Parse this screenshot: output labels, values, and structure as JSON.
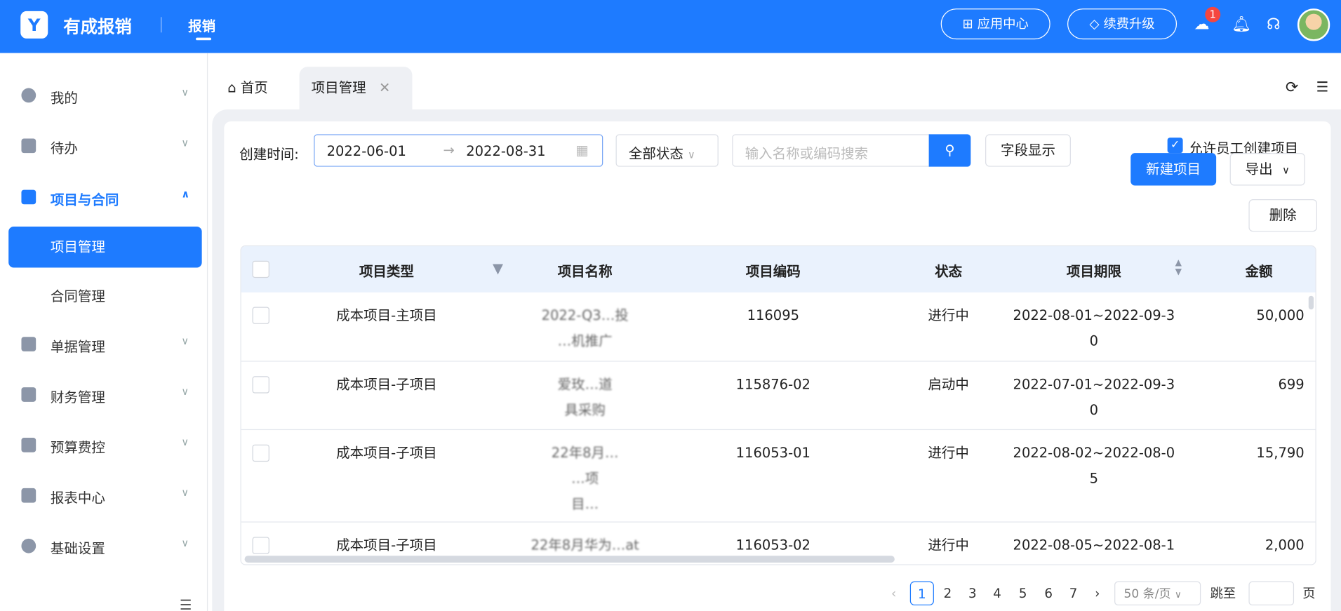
{
  "header": {
    "logo_letter": "Y",
    "brand": "有成报销",
    "nav_active": "报销",
    "app_center": "应用中心",
    "upgrade": "续费升级",
    "download_badge": "1"
  },
  "sidebar": {
    "items": [
      {
        "label": "我的",
        "icon": "user-icon"
      },
      {
        "label": "待办",
        "icon": "todo-icon"
      },
      {
        "label": "项目与合同",
        "icon": "project-icon",
        "expanded": true,
        "children": [
          "项目管理",
          "合同管理"
        ],
        "selected": "项目管理"
      },
      {
        "label": "单据管理",
        "icon": "document-icon"
      },
      {
        "label": "财务管理",
        "icon": "finance-icon"
      },
      {
        "label": "预算费控",
        "icon": "budget-icon"
      },
      {
        "label": "报表中心",
        "icon": "report-icon"
      },
      {
        "label": "基础设置",
        "icon": "settings-icon"
      }
    ]
  },
  "tabs": {
    "home": "首页",
    "active": "项目管理"
  },
  "filters": {
    "date_label": "创建时间:",
    "date_start": "2022-06-01",
    "date_end": "2022-08-31",
    "status": "全部状态",
    "search_placeholder": "输入名称或编码搜索",
    "field_display": "字段显示",
    "allow_create": "允许员工创建项目",
    "new_project": "新建项目",
    "export": "导出",
    "delete": "删除"
  },
  "table": {
    "columns": [
      "项目类型",
      "项目名称",
      "项目编码",
      "状态",
      "项目期限",
      "金额"
    ],
    "rows": [
      {
        "type": "成本项目-主项目",
        "name": [
          "2022-Q3…投",
          "…机推广"
        ],
        "code": "116095",
        "status": "进行中",
        "period": [
          "2022-08-01~2022-09-3",
          "0"
        ],
        "amount": "50,000"
      },
      {
        "type": "成本项目-子项目",
        "name": [
          "爱玫…道",
          "具采购"
        ],
        "code": "115876-02",
        "status": "启动中",
        "period": [
          "2022-07-01~2022-09-3",
          "0"
        ],
        "amount": "699"
      },
      {
        "type": "成本项目-子项目",
        "name": [
          "22年8月…",
          "…项",
          "目…"
        ],
        "code": "116053-01",
        "status": "进行中",
        "period": [
          "2022-08-02~2022-08-0",
          "5"
        ],
        "amount": "15,790"
      },
      {
        "type": "成本项目-子项目",
        "name": [
          "22年8月华为…at"
        ],
        "code": "116053-02",
        "status": "进行中",
        "period": [
          "2022-08-05~2022-08-1"
        ],
        "amount": "2,000"
      }
    ]
  },
  "pagination": {
    "pages": [
      "1",
      "2",
      "3",
      "4",
      "5",
      "6",
      "7"
    ],
    "current": "1",
    "page_size": "50 条/页",
    "jump_label": "跳至",
    "page_suffix": "页"
  }
}
